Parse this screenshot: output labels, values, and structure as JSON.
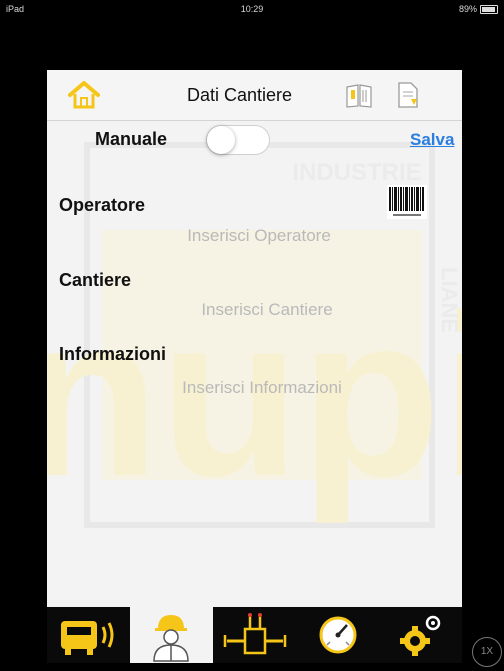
{
  "status_bar": {
    "device": "iPad",
    "time": "10:29",
    "battery": "89%"
  },
  "header": {
    "title": "Dati Cantiere"
  },
  "manual": {
    "label": "Manuale",
    "enabled": false
  },
  "save_label": "Salva",
  "watermark": {
    "brand": "nupi",
    "line1": "INDUSTRIE",
    "line2": "LIANE"
  },
  "fields": {
    "operatore": {
      "label": "Operatore",
      "placeholder": "Inserisci Operatore",
      "value": ""
    },
    "cantiere": {
      "label": "Cantiere",
      "placeholder": "Inserisci Cantiere",
      "value": ""
    },
    "informazioni": {
      "label": "Informazioni",
      "placeholder": "Inserisci Informazioni",
      "value": ""
    }
  },
  "tabs": [
    {
      "icon": "welding-machine-icon",
      "active": false
    },
    {
      "icon": "operator-icon",
      "active": true
    },
    {
      "icon": "pipe-fitting-icon",
      "active": false
    },
    {
      "icon": "pressure-gauge-icon",
      "active": false
    },
    {
      "icon": "settings-gears-icon",
      "active": false
    }
  ],
  "zoom_label": "1X",
  "colors": {
    "accent_yellow": "#f5c518",
    "link_blue": "#2a7de1",
    "tab_bar": "#0a0a0a"
  }
}
